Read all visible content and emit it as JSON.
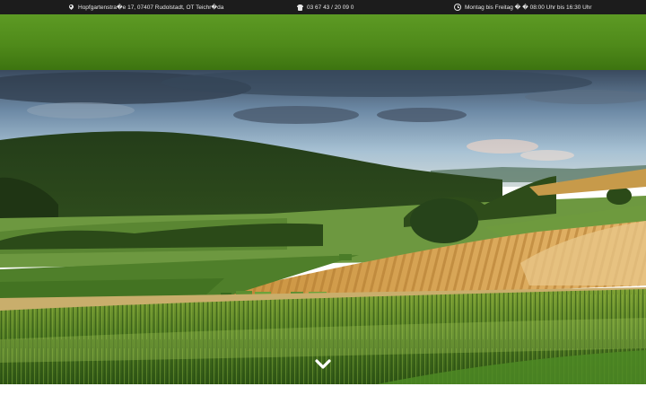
{
  "topbar": {
    "address": "Hopfgartenstra�e 17, 07407 Rudolstadt, OT Teichr�da",
    "phone": "03 67 43 / 20 09 0",
    "hours": "Montag bis Freitag � � 08:00 Uhr bis 16:30 Uhr",
    "icons": {
      "address": "map-pin-icon",
      "phone": "phone-icon",
      "hours": "clock-icon"
    },
    "colors": {
      "background": "#1c1c1c",
      "text": "#e6e6e6"
    }
  },
  "header": {
    "color": "#4f8a1a"
  },
  "hero": {
    "image": "farmland landscape with wooded hills, harvested wheat fields and cornfield",
    "scroll_icon": "chevron-down-icon"
  }
}
